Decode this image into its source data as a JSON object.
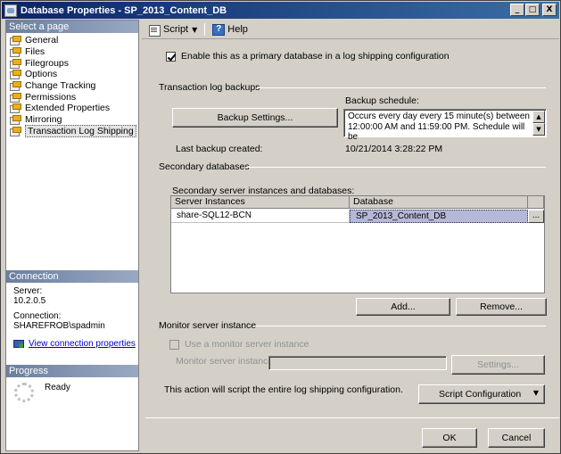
{
  "window": {
    "title": "Database Properties - SP_2013_Content_DB",
    "controls": [
      "_",
      "□",
      "X"
    ]
  },
  "left_pane": {
    "select_header": "Select a page",
    "pages": [
      {
        "label": "General"
      },
      {
        "label": "Files"
      },
      {
        "label": "Filegroups"
      },
      {
        "label": "Options"
      },
      {
        "label": "Change Tracking"
      },
      {
        "label": "Permissions"
      },
      {
        "label": "Extended Properties"
      },
      {
        "label": "Mirroring"
      },
      {
        "label": "Transaction Log Shipping"
      }
    ],
    "connection": {
      "header": "Connection",
      "server_label": "Server:",
      "server_value": "10.2.0.5",
      "connection_label": "Connection:",
      "connection_value": "SHAREFROB\\spadmin",
      "link": "View connection properties"
    },
    "progress": {
      "header": "Progress",
      "status": "Ready"
    }
  },
  "toolbar": {
    "script_label": "Script",
    "help_label": "Help"
  },
  "main": {
    "primary_checkbox_label": "Enable this as a primary database in a log shipping configuration",
    "tlog_group": "Transaction log backups",
    "backup_schedule_label": "Backup schedule:",
    "backup_settings_button": "Backup Settings...",
    "schedule_text": "Occurs every day every 15 minute(s) between 12:00:00 AM and 11:59:00 PM. Schedule will be",
    "last_backup_label": "Last backup created:",
    "last_backup_value": "10/21/2014 3:28:22 PM",
    "secondary_group": "Secondary databases",
    "secondary_grid_label": "Secondary server instances and databases:",
    "grid": {
      "columns": [
        "Server Instances",
        "Database"
      ],
      "rows": [
        {
          "server": "share-SQL12-BCN",
          "database": "SP_2013_Content_DB",
          "browse": "..."
        }
      ]
    },
    "add_button": "Add...",
    "remove_button": "Remove...",
    "monitor_group": "Monitor server instance",
    "use_monitor_label": "Use a monitor server instance",
    "monitor_instance_label": "Monitor server instance",
    "settings_button": "Settings...",
    "script_note": "This action will script the entire log shipping configuration.",
    "script_config_button": "Script Configuration"
  },
  "footer": {
    "ok_button": "OK",
    "cancel_button": "Cancel"
  }
}
